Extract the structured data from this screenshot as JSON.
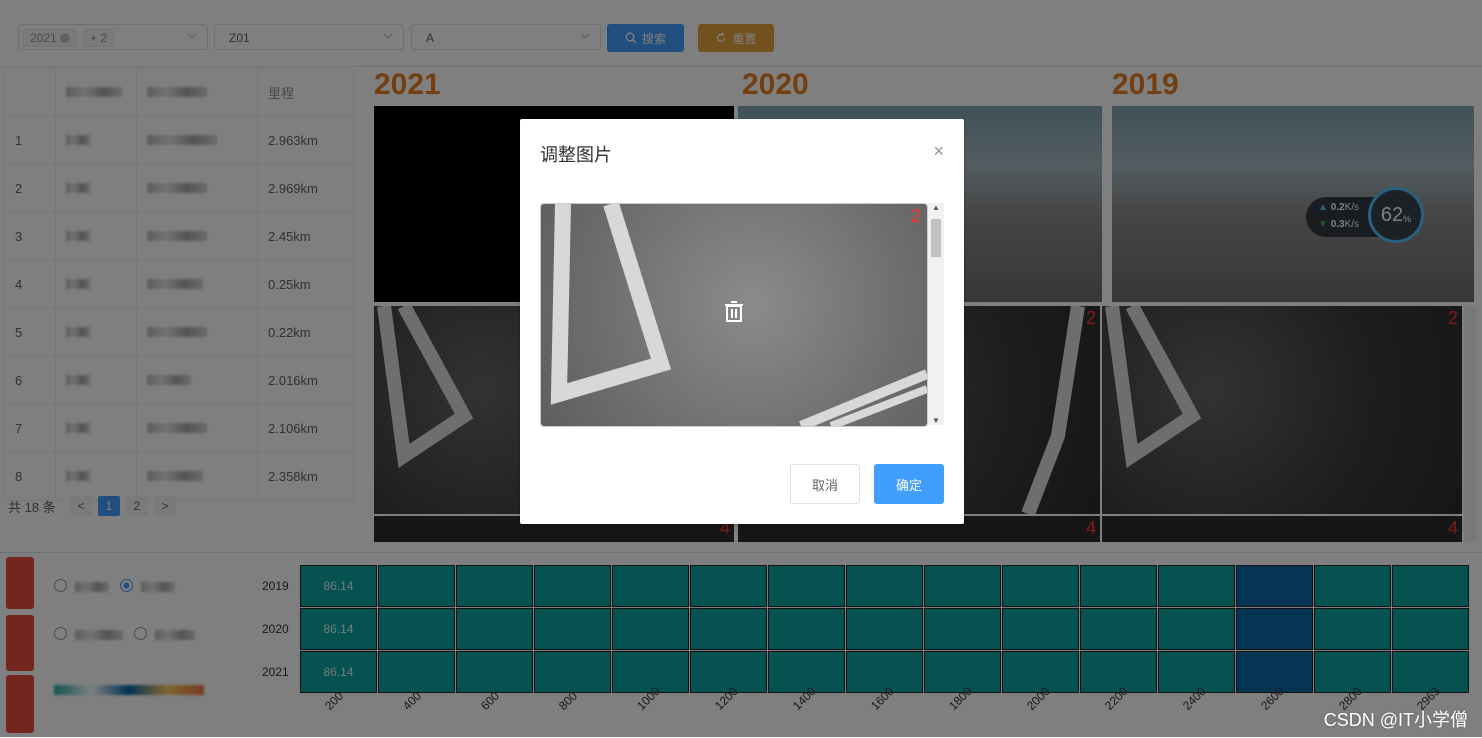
{
  "toolbar": {
    "year_select": {
      "tag": "2021",
      "more": "+ 2"
    },
    "route_select": {
      "value": "Z01"
    },
    "lane_select": {
      "value": "A"
    },
    "search_label": "搜索",
    "reset_label": "重置"
  },
  "table": {
    "header_mileage": "里程",
    "rows": [
      {
        "idx": "1",
        "mileage": "2.963km"
      },
      {
        "idx": "2",
        "mileage": "2.969km"
      },
      {
        "idx": "3",
        "mileage": "2.45km"
      },
      {
        "idx": "4",
        "mileage": "0.25km"
      },
      {
        "idx": "5",
        "mileage": "0.22km"
      },
      {
        "idx": "6",
        "mileage": "2.016km"
      },
      {
        "idx": "7",
        "mileage": "2.106km"
      },
      {
        "idx": "8",
        "mileage": "2.358km"
      }
    ]
  },
  "pagination": {
    "total": "共 18 条",
    "pages": [
      "1",
      "2"
    ],
    "prev": "<",
    "next": ">"
  },
  "image_grid": {
    "years": [
      "2021",
      "2020",
      "2019"
    ],
    "labels": {
      "top_right_num": "2",
      "bottom_right_num": "4"
    }
  },
  "net_monitor": {
    "up": "0.2",
    "down": "0.3",
    "unit": "K/s",
    "percent": "62",
    "pct_sign": "%"
  },
  "heatmap": {
    "years": [
      "2019",
      "2020",
      "2021"
    ],
    "first_value": "86.14",
    "x_ticks": [
      "200",
      "400",
      "600",
      "800",
      "1000",
      "1200",
      "1400",
      "1600",
      "1800",
      "2000",
      "2200",
      "2400",
      "2600",
      "2800",
      "2963"
    ],
    "colors": {
      "normal": "#0aa5a0",
      "highlight": "#0a6aa6"
    }
  },
  "modal": {
    "title": "调整图片",
    "close": "×",
    "image_num": "2",
    "cancel": "取消",
    "confirm": "确定"
  },
  "watermark": "CSDN @IT小学僧",
  "colors": {
    "primary": "#409eff",
    "reset": "#e6a23c",
    "year": "#e67e22",
    "red": "#e74c3c"
  }
}
